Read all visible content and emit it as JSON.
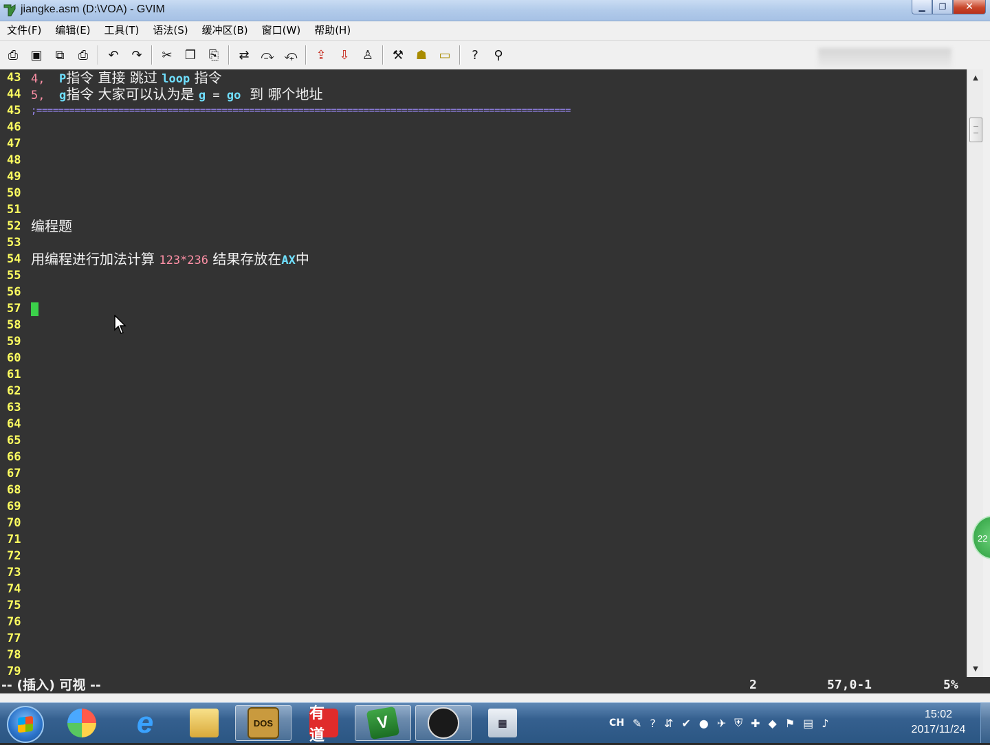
{
  "window": {
    "title": "jiangke.asm (D:\\VOA) - GVIM",
    "minimize": "▁",
    "maximize": "❐",
    "close": "✕"
  },
  "menu": [
    "文件(F)",
    "编辑(E)",
    "工具(T)",
    "语法(S)",
    "缓冲区(B)",
    "窗口(W)",
    "帮助(H)"
  ],
  "toolbar": {
    "icons": [
      "open-icon",
      "save-icon",
      "save-all-icon",
      "print-icon",
      "undo-icon",
      "redo-icon",
      "cut-icon",
      "copy-icon",
      "paste-icon",
      "find-replace-icon",
      "find-next-icon",
      "find-prev-icon",
      "load-session-icon",
      "save-session-icon",
      "run-script-icon",
      "make-icon",
      "shell-icon",
      "tags-icon",
      "help-icon",
      "find-help-icon"
    ]
  },
  "editor": {
    "lines": [
      {
        "num": "43",
        "segments": [
          {
            "t": "4,  ",
            "c": "c-num mono"
          },
          {
            "t": "P",
            "c": "c-cyan mono"
          },
          {
            "t": "指令 直接 跳过 ",
            "c": "c-white"
          },
          {
            "t": "loop",
            "c": "c-cyan mono"
          },
          {
            "t": " 指令",
            "c": "c-white"
          }
        ]
      },
      {
        "num": "44",
        "segments": [
          {
            "t": "5,  ",
            "c": "c-num mono"
          },
          {
            "t": "g",
            "c": "c-cyan mono"
          },
          {
            "t": "指令 大家可以认为是 ",
            "c": "c-white"
          },
          {
            "t": "g",
            "c": "c-cyan mono"
          },
          {
            "t": " = ",
            "c": "c-white mono"
          },
          {
            "t": "go",
            "c": "c-cyan mono"
          },
          {
            "t": "  到 哪个地址",
            "c": "c-white"
          }
        ]
      },
      {
        "num": "45",
        "sep": ";=================================================================================================="
      },
      {
        "num": "46",
        "segments": []
      },
      {
        "num": "47",
        "segments": []
      },
      {
        "num": "48",
        "segments": []
      },
      {
        "num": "49",
        "segments": []
      },
      {
        "num": "50",
        "segments": []
      },
      {
        "num": "51",
        "segments": []
      },
      {
        "num": "52",
        "segments": [
          {
            "t": "编程题",
            "c": "c-white"
          }
        ]
      },
      {
        "num": "53",
        "segments": []
      },
      {
        "num": "54",
        "segments": [
          {
            "t": "用编程进行加法计算 ",
            "c": "c-white"
          },
          {
            "t": "123*236",
            "c": "c-num mono"
          },
          {
            "t": " 结果存放在",
            "c": "c-white"
          },
          {
            "t": "AX",
            "c": "c-cyan mono"
          },
          {
            "t": "中",
            "c": "c-white"
          }
        ]
      },
      {
        "num": "55",
        "segments": []
      },
      {
        "num": "56",
        "segments": []
      },
      {
        "num": "57",
        "cursor": true,
        "segments": []
      },
      {
        "num": "58",
        "segments": []
      },
      {
        "num": "59",
        "segments": []
      },
      {
        "num": "60",
        "segments": []
      },
      {
        "num": "61",
        "segments": []
      },
      {
        "num": "62",
        "segments": []
      },
      {
        "num": "63",
        "segments": []
      },
      {
        "num": "64",
        "segments": []
      },
      {
        "num": "65",
        "segments": []
      },
      {
        "num": "66",
        "segments": []
      },
      {
        "num": "67",
        "segments": []
      },
      {
        "num": "68",
        "segments": []
      },
      {
        "num": "69",
        "segments": []
      },
      {
        "num": "70",
        "segments": []
      },
      {
        "num": "71",
        "segments": []
      },
      {
        "num": "72",
        "segments": []
      },
      {
        "num": "73",
        "segments": []
      },
      {
        "num": "74",
        "segments": []
      },
      {
        "num": "75",
        "segments": []
      },
      {
        "num": "76",
        "segments": []
      },
      {
        "num": "77",
        "segments": []
      },
      {
        "num": "78",
        "segments": []
      },
      {
        "num": "79",
        "segments": []
      }
    ]
  },
  "status": {
    "mode": "-- (插入) 可视 --",
    "count": "2",
    "position": "57,0-1",
    "percent": "5%"
  },
  "float_badge": "22",
  "taskbar": {
    "apps": [
      "start-button",
      "colors-app",
      "ie-app",
      "explorer-app",
      "dosbox-app",
      "youdao-app",
      "gvim-app",
      "obs-app",
      "calculator-app"
    ],
    "dosbox_label": "DOS",
    "youdao_label": "有道",
    "vim_label": "V",
    "calc_label": "▦",
    "ie_label": "e",
    "tray_lang": "CH",
    "time": "15:02",
    "date": "2017/11/24"
  },
  "colors": {
    "editor_bg": "#333333",
    "line_number": "#ffff60",
    "cursor": "#3bd14a",
    "keyword": "#70e0ff",
    "number": "#ff90a6",
    "separator": "#9f8cff"
  }
}
